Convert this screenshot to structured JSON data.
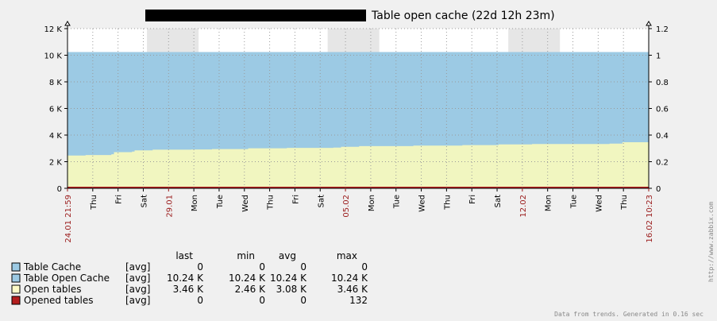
{
  "title": "Table open cache  (22d 12h 23m)",
  "chart_data": {
    "type": "area",
    "y_left": {
      "ticks": [
        "0",
        "2 K",
        "4 K",
        "6 K",
        "8 K",
        "10 K",
        "12 K"
      ],
      "ylim": [
        0,
        12000
      ]
    },
    "y_right": {
      "ticks": [
        "0",
        "0.2",
        "0.4",
        "0.6",
        "0.8",
        "1",
        "1.2"
      ],
      "ylim": [
        0,
        1.2
      ]
    },
    "x_ticks": [
      {
        "label": "24.01 21:59",
        "red": true
      },
      {
        "label": "Thu",
        "red": false
      },
      {
        "label": "Fri",
        "red": false
      },
      {
        "label": "Sat",
        "red": false
      },
      {
        "label": "29.01",
        "red": true
      },
      {
        "label": "Mon",
        "red": false
      },
      {
        "label": "Tue",
        "red": false
      },
      {
        "label": "Wed",
        "red": false
      },
      {
        "label": "Thu",
        "red": false
      },
      {
        "label": "Fri",
        "red": false
      },
      {
        "label": "Sat",
        "red": false
      },
      {
        "label": "05.02",
        "red": true
      },
      {
        "label": "Mon",
        "red": false
      },
      {
        "label": "Tue",
        "red": false
      },
      {
        "label": "Wed",
        "red": false
      },
      {
        "label": "Thu",
        "red": false
      },
      {
        "label": "Fri",
        "red": false
      },
      {
        "label": "Sat",
        "red": false
      },
      {
        "label": "12.02",
        "red": true
      },
      {
        "label": "Mon",
        "red": false
      },
      {
        "label": "Tue",
        "red": false
      },
      {
        "label": "Wed",
        "red": false
      },
      {
        "label": "Thu",
        "red": false
      },
      {
        "label": "16.02 10:23",
        "red": true
      }
    ],
    "weekend_bands_days": [
      [
        3.08,
        5.08
      ],
      [
        10.08,
        12.08
      ],
      [
        17.08,
        19.08
      ]
    ],
    "series": [
      {
        "name": "Table Cache",
        "color": "#9ccae4",
        "values_days": [
          [
            0,
            0
          ],
          [
            22.52,
            0
          ]
        ]
      },
      {
        "name": "Table Open Cache",
        "color": "#9ccae4",
        "values_days": [
          [
            0,
            10240
          ],
          [
            22.52,
            10240
          ]
        ]
      },
      {
        "name": "Open tables",
        "color": "#f1f6c0",
        "values_days": [
          [
            0,
            2460
          ],
          [
            0.7,
            2500
          ],
          [
            1.7,
            2560
          ],
          [
            1.8,
            2720
          ],
          [
            2.5,
            2760
          ],
          [
            2.6,
            2850
          ],
          [
            3.3,
            2900
          ],
          [
            4.8,
            2920
          ],
          [
            5.6,
            2950
          ],
          [
            7.0,
            3010
          ],
          [
            8.5,
            3040
          ],
          [
            10.3,
            3060
          ],
          [
            10.6,
            3120
          ],
          [
            11.3,
            3170
          ],
          [
            13.4,
            3210
          ],
          [
            15.3,
            3250
          ],
          [
            16.7,
            3300
          ],
          [
            18.0,
            3330
          ],
          [
            21.0,
            3360
          ],
          [
            21.5,
            3460
          ],
          [
            22.52,
            3460
          ]
        ]
      },
      {
        "name": "Opened tables",
        "color": "#b41e1e",
        "values_days": [
          [
            0,
            0
          ],
          [
            22.52,
            0
          ]
        ]
      }
    ]
  },
  "legend": {
    "headers": [
      "last",
      "min",
      "avg",
      "max"
    ],
    "rows": [
      {
        "name": "Table Cache",
        "func": "[avg]",
        "last": "0",
        "min": "0",
        "avg": "0",
        "max": "0",
        "color": "#9ccae4"
      },
      {
        "name": "Table Open Cache",
        "func": "[avg]",
        "last": "10.24 K",
        "min": "10.24 K",
        "avg": "10.24 K",
        "max": "10.24 K",
        "color": "#9ccae4"
      },
      {
        "name": "Open tables",
        "func": "[avg]",
        "last": "3.46 K",
        "min": "2.46 K",
        "avg": "3.08 K",
        "max": "3.46 K",
        "color": "#fdfbc7"
      },
      {
        "name": "Opened tables",
        "func": "[avg]",
        "last": "0",
        "min": "0",
        "avg": "0",
        "max": "132",
        "color": "#b41e1e"
      }
    ]
  },
  "footer": "Data from trends. Generated in 0.16 sec",
  "watermark": "http://www.zabbix.com"
}
